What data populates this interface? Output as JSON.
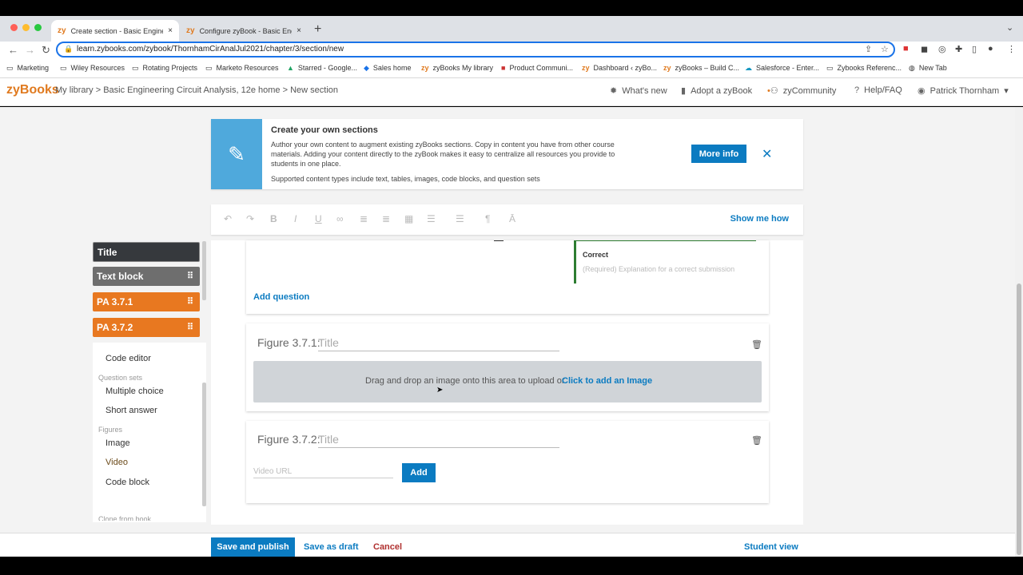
{
  "browser": {
    "tabs": [
      {
        "label": "Create section - Basic Enginee",
        "favicon": "zy",
        "close": "×"
      },
      {
        "label": "Configure zyBook - Basic Engin",
        "favicon": "zy",
        "close": "×"
      }
    ],
    "new_tab": "+",
    "url": "learn.zybooks.com/zybook/ThornhamCirAnalJul2021/chapter/3/section/new",
    "bookmarks": [
      "Marketing",
      "Wiley Resources",
      "Rotating Projects",
      "Marketo Resources",
      "Starred - Google...",
      "Sales home",
      "zyBooks My library",
      "Product Communi...",
      "Dashboard ‹ zyBo...",
      "zyBooks – Build C...",
      "Salesforce - Enter...",
      "Zybooks Referenc...",
      "New Tab"
    ]
  },
  "header": {
    "logo": "zyBooks",
    "breadcrumb": "My library > Basic Engineering Circuit Analysis, 12e home > New section",
    "whats_new": "What's new",
    "adopt": "Adopt a zyBook",
    "community": "zyCommunity",
    "help": "Help/FAQ",
    "user": "Patrick Thornham"
  },
  "banner": {
    "title": "Create your own sections",
    "body": "Author your own content to augment existing zyBooks sections. Copy in content you have from other course materials. Adding your content directly to the zyBook makes it easy to centralize all resources you provide to students in one place.",
    "supported": "Supported content types include text, tables, images, code blocks, and question sets",
    "more_info": "More info",
    "close": "✕"
  },
  "editor_toolbar": {
    "show_me_how": "Show me how"
  },
  "question": {
    "correct_label": "Correct",
    "explanation_placeholder": "(Required) Explanation for a correct submission",
    "add_question": "Add question"
  },
  "figure1": {
    "label": "Figure 3.7.1:",
    "title_placeholder": "Title",
    "drop_text": "Drag and drop an image onto this area to upload or",
    "click_text": "Click to add an Image"
  },
  "figure2": {
    "label": "Figure 3.7.2:",
    "title_placeholder": "Title",
    "video_placeholder": "Video URL",
    "add": "Add"
  },
  "sidebar": {
    "blocks": [
      {
        "label": "Title"
      },
      {
        "label": "Text block"
      },
      {
        "label": "PA 3.7.1"
      },
      {
        "label": "PA 3.7.2"
      }
    ],
    "palette": {
      "code_editor": "Code editor",
      "question_sets_head": "Question sets",
      "multiple_choice": "Multiple choice",
      "short_answer": "Short answer",
      "figures_head": "Figures",
      "image": "Image",
      "video": "Video",
      "code_block": "Code block",
      "cut_off": "Clone from book"
    }
  },
  "footer": {
    "save_publish": "Save and publish",
    "save_draft": "Save as draft",
    "cancel": "Cancel",
    "student_view": "Student view"
  },
  "colors": {
    "brand_orange": "#e07a1f",
    "action_blue": "#0b7bc1",
    "cancel_red": "#b0302f",
    "correct_green": "#2e7d32"
  }
}
